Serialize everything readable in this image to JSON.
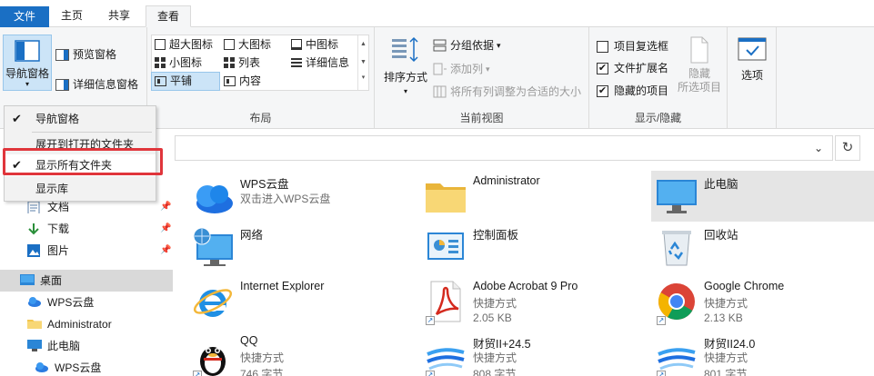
{
  "tabs": {
    "file": "文件",
    "home": "主页",
    "share": "共享",
    "view": "查看"
  },
  "ribbon": {
    "panes": {
      "nav_pane_label": "导航窗格",
      "preview_pane": "预览窗格",
      "details_pane": "详细信息窗格"
    },
    "layout": {
      "label": "布局",
      "items": [
        "超大图标",
        "大图标",
        "中图标",
        "小图标",
        "列表",
        "详细信息",
        "平铺",
        "内容"
      ],
      "selected": "平铺"
    },
    "current_view": {
      "label": "当前视图",
      "sort_by": "排序方式",
      "group_by": "分组依据",
      "add_columns": "添加列",
      "size_columns": "将所有列调整为合适的大小"
    },
    "show_hide": {
      "label": "显示/隐藏",
      "item_checkboxes": "项目复选框",
      "item_checkboxes_checked": false,
      "file_extensions": "文件扩展名",
      "file_extensions_checked": true,
      "hidden_items": "隐藏的项目",
      "hidden_items_checked": true,
      "hide_selected_line1": "隐藏",
      "hide_selected_line2": "所选项目"
    },
    "options": "选项"
  },
  "nav_menu": {
    "items": [
      {
        "label": "导航窗格",
        "checked": true
      },
      {
        "label": "展开到打开的文件夹",
        "checked": false
      },
      {
        "label": "显示所有文件夹",
        "checked": true
      },
      {
        "label": "显示库",
        "checked": false
      }
    ]
  },
  "nav_pane": {
    "quick": [
      {
        "label": "文档",
        "pinned": true
      },
      {
        "label": "下载",
        "pinned": true
      },
      {
        "label": "图片",
        "pinned": true
      }
    ],
    "tree": [
      {
        "label": "桌面",
        "selected": true
      },
      {
        "label": "WPS云盘"
      },
      {
        "label": "Administrator"
      },
      {
        "label": "此电脑"
      },
      {
        "label": "WPS云盘"
      }
    ]
  },
  "content": {
    "items": [
      {
        "name": "WPS云盘",
        "sub1": "双击进入WPS云盘",
        "sub2": ""
      },
      {
        "name": "Administrator",
        "sub1": "",
        "sub2": ""
      },
      {
        "name": "此电脑",
        "sub1": "",
        "sub2": ""
      },
      {
        "name": "网络",
        "sub1": "",
        "sub2": ""
      },
      {
        "name": "控制面板",
        "sub1": "",
        "sub2": ""
      },
      {
        "name": "回收站",
        "sub1": "",
        "sub2": ""
      },
      {
        "name": "Internet Explorer",
        "sub1": "",
        "sub2": ""
      },
      {
        "name": "Adobe Acrobat 9 Pro",
        "sub1": "快捷方式",
        "sub2": "2.05 KB"
      },
      {
        "name": "Google Chrome",
        "sub1": "快捷方式",
        "sub2": "2.13 KB"
      },
      {
        "name": "QQ",
        "sub1": "快捷方式",
        "sub2": "746 字节"
      },
      {
        "name": "财贸II+24.5",
        "sub1": "快捷方式",
        "sub2": "808 字节"
      },
      {
        "name": "财贸II24.0",
        "sub1": "快捷方式",
        "sub2": "801 字节"
      }
    ]
  },
  "colors": {
    "accent": "#1a6fc4",
    "selection": "#cce4f7",
    "highlight_box": "#e0353b"
  }
}
